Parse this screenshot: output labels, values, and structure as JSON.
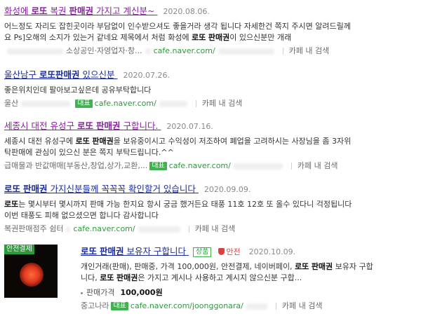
{
  "results": [
    {
      "title_a": "화성에",
      "title_bold1": "로또",
      "title_b": "복권",
      "title_bold2": "판매권",
      "title_c": "가지고 계신분~",
      "date": "2020.08.06.",
      "desc1": "어느정도 자리도 잡힌곳이라 부담없이 인수받으셔도 좋을거라 생각 됩니다 자세한건 쪽지 주시면 알려드릴께",
      "desc2_a": "요 Ps]오해의 소지가 있는거 같네요 제목에서 처럼 화성에",
      "desc2_bold1": "로또",
      "desc2_bold2": "판매권",
      "desc2_b": "이 있으신분만 개래",
      "cafe_name": "소상공인·자영업자·창...",
      "url": "cafe.naver.com/",
      "cafe_search": "카페 내 검색"
    },
    {
      "title_a": "울산남구",
      "title_bold1": "로또판매권",
      "title_b": "있으신분",
      "date": "2020.07.26.",
      "desc1": "좋은위치인데 팔아보고싶은데 공유부탁합니다",
      "cafe_name": "울산",
      "badge": "대표",
      "url": "cafe.naver.com/",
      "cafe_search": "카페 내 검색"
    },
    {
      "title_a": "세종시 대전 유성구",
      "title_bold1": "로또",
      "title_bold2": "판매권",
      "title_b": "구합니다.",
      "date": "2020.07.16.",
      "desc1_a": "세종시 대전 유성구에",
      "desc1_bold1": "로또",
      "desc1_bold2": "판매권",
      "desc1_b": "을 보유중이시고 수익성이 저조하여 폐업을 고려하시는 사장님을 좀 3자위",
      "desc2": "탁판매에 관심이 있으신 분은 쪽지 부탁드립니다.^^",
      "cafe_name": "급매물과 반값매매[부동산,창업,상가,교환,...",
      "badge": "대표",
      "url": "cafe.naver.com/",
      "cafe_search": "카페 내 검색"
    },
    {
      "title_bold1": "로또",
      "title_bold2": "판매권",
      "title_a": "가지신분들께 꼭꼭꼭 확인할거 있습니다",
      "date": "2020.09.09.",
      "desc1_bold": "로또",
      "desc1_a": "는 몇시부터 몇시까지 판매 가능 한지요 항시 궁금 했거든요 태풍 11호 12호 또 올수 있다니 걱정됩니다",
      "desc2": "이번 태풍도 피해 없으셨으면 합니다 감사합니다",
      "cafe_name": "복권판매점주 쉼터",
      "url": "cafe.naver.com/",
      "cafe_search": "카페 내 검색"
    },
    {
      "thumb_label": "안전결제",
      "title_bold1": "로또",
      "title_bold2": "판매권",
      "title_a": "보유자 구합니다",
      "pill": "상품",
      "safe": "안전",
      "date": "2020.10.09.",
      "desc1": "개인거래(판매), 판매중, 가격 100,000원, 안전결제, 네이버페이,",
      "desc1_bold1": "로또",
      "desc1_bold2": "판매권",
      "desc1_b": "보유자 구합",
      "desc2_a": "니다,",
      "desc2_bold1": "로또",
      "desc2_bold2": "판매권",
      "desc2_b": "은 가지고 계시나 사용하고 계시지 않으신분 구합...",
      "price_label": "판매가격",
      "price_value": "100,000원",
      "cafe_name": "중고나라",
      "badge": "대표",
      "url": "cafe.naver.com/joonggonara/",
      "cafe_search": "카페 내 검색"
    }
  ]
}
